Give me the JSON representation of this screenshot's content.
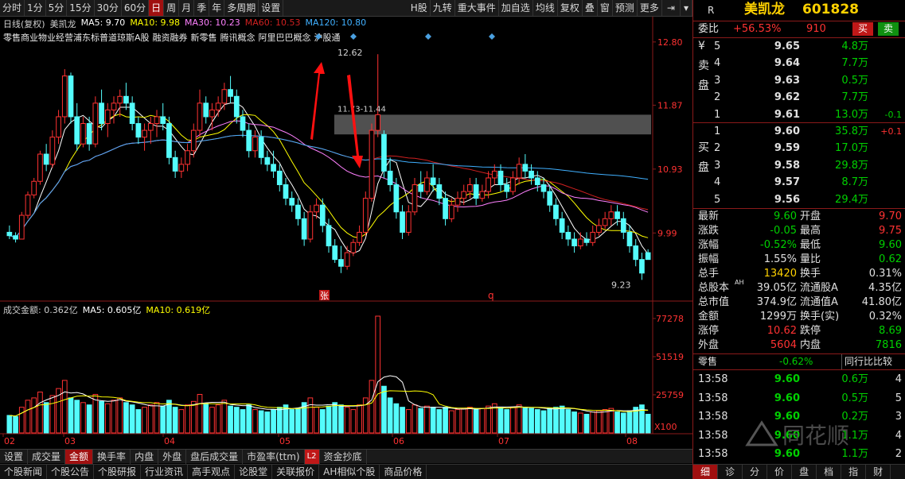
{
  "toolbar": {
    "items": [
      "分时",
      "1分",
      "5分",
      "15分",
      "30分",
      "60分",
      "日",
      "周",
      "月",
      "季",
      "年",
      "多周期",
      "设置"
    ],
    "active_index": 6,
    "right_items": [
      "H股",
      "九转",
      "重大事件",
      "加自选",
      "均线",
      "复权",
      "叠",
      "窗",
      "预测",
      "更多"
    ]
  },
  "stock": {
    "code_letter": "R",
    "name": "美凯龙",
    "code": "601828"
  },
  "legend": {
    "period": "日线(复权)",
    "name": "美凯龙",
    "ma5": "MA5: 9.70",
    "ma10": "MA10: 9.98",
    "ma30": "MA30: 10.23",
    "ma60": "MA60: 10.53",
    "ma120": "MA120: 10.80"
  },
  "concepts": [
    "零售商业物业经营浦东标普道琼斯A股",
    "融资融券",
    "新零售",
    "腾讯概念",
    "阿里巴巴概念",
    "沪股通"
  ],
  "price_axis": {
    "ticks": [
      "12.80",
      "11.87",
      "10.93",
      "9.99"
    ],
    "annot_high": "12.62",
    "annot_gap": "11.73-11.44",
    "annot_low": "9.23"
  },
  "markers": {
    "zhang": "张",
    "q": "q"
  },
  "vol_legend": {
    "label": "成交金额: 0.362亿",
    "ma5": "MA5: 0.605亿",
    "ma10": "MA10: 0.619亿"
  },
  "vol_axis": {
    "ticks": [
      "77278",
      "51519",
      "25759"
    ],
    "unit": "X100"
  },
  "months": [
    "02",
    "03",
    "04",
    "05",
    "06",
    "07",
    "08"
  ],
  "bottom_tabs": [
    "设置",
    "成交量",
    "金额",
    "换手率",
    "内盘",
    "外盘",
    "盘后成交量",
    "市盈率(ttm)",
    "资金抄底"
  ],
  "bottom_active_index": 2,
  "bottom_badge": "L2",
  "news_tabs": [
    "个股新闻",
    "个股公告",
    "个股研报",
    "行业资讯",
    "高手观点",
    "论股堂",
    "关联报价",
    "AH相似个股",
    "商品价格"
  ],
  "weibi": {
    "label": "委比",
    "pct": "+56.53%",
    "diff": "910",
    "buy": "买",
    "sell": "卖"
  },
  "sell_side": {
    "label": [
      "¥",
      "卖",
      "盘"
    ],
    "rows": [
      {
        "n": "5",
        "p": "9.65",
        "v": "4.8万",
        "c": ""
      },
      {
        "n": "4",
        "p": "9.64",
        "v": "7.7万",
        "c": ""
      },
      {
        "n": "3",
        "p": "9.63",
        "v": "0.5万",
        "c": ""
      },
      {
        "n": "2",
        "p": "9.62",
        "v": "7.7万",
        "c": ""
      },
      {
        "n": "1",
        "p": "9.61",
        "v": "13.0万",
        "c": "-0.1"
      }
    ]
  },
  "buy_side": {
    "label": [
      "买",
      "盘"
    ],
    "rows": [
      {
        "n": "1",
        "p": "9.60",
        "v": "35.8万",
        "c": "+0.1"
      },
      {
        "n": "2",
        "p": "9.59",
        "v": "17.0万",
        "c": ""
      },
      {
        "n": "3",
        "p": "9.58",
        "v": "29.8万",
        "c": ""
      },
      {
        "n": "4",
        "p": "9.57",
        "v": "8.7万",
        "c": ""
      },
      {
        "n": "5",
        "p": "9.56",
        "v": "29.4万",
        "c": ""
      }
    ]
  },
  "quote": [
    {
      "l1": "最新",
      "v1": "9.60",
      "c1": "green",
      "l2": "开盘",
      "v2": "9.70",
      "c2": "red"
    },
    {
      "l1": "涨跌",
      "v1": "-0.05",
      "c1": "green",
      "l2": "最高",
      "v2": "9.75",
      "c2": "red"
    },
    {
      "l1": "涨幅",
      "v1": "-0.52%",
      "c1": "green",
      "l2": "最低",
      "v2": "9.60",
      "c2": "green"
    },
    {
      "l1": "振幅",
      "v1": "1.55%",
      "c1": "white",
      "l2": "量比",
      "v2": "0.62",
      "c2": "green"
    },
    {
      "l1": "总手",
      "v1": "13420",
      "c1": "yellow",
      "l2": "换手",
      "v2": "0.31%",
      "c2": "white"
    },
    {
      "l1": "总股本",
      "v1": "39.05亿",
      "c1": "white",
      "l2": "流通股A",
      "v2": "4.35亿",
      "c2": "white"
    },
    {
      "l1": "总市值",
      "v1": "374.9亿",
      "c1": "white",
      "l2": "流通值A",
      "v2": "41.80亿",
      "c2": "white"
    },
    {
      "l1": "金额",
      "v1": "1299万",
      "c1": "white",
      "l2": "换手(实)",
      "v2": "0.32%",
      "c2": "white"
    },
    {
      "l1": "涨停",
      "v1": "10.62",
      "c1": "red",
      "l2": "跌停",
      "v2": "8.69",
      "c2": "green"
    },
    {
      "l1": "外盘",
      "v1": "5604",
      "c1": "red",
      "l2": "内盘",
      "v2": "7816",
      "c2": "green"
    }
  ],
  "ah_sup": "AH",
  "sector": {
    "label": "零售",
    "pct": "-0.62%",
    "compare": "同行比比较"
  },
  "ticks": [
    {
      "t": "13:58",
      "p": "9.60",
      "v": "0.6万",
      "n": "4"
    },
    {
      "t": "13:58",
      "p": "9.60",
      "v": "0.5万",
      "n": "5"
    },
    {
      "t": "13:58",
      "p": "9.60",
      "v": "0.2万",
      "n": "3"
    },
    {
      "t": "13:58",
      "p": "9.60",
      "v": "1.1万",
      "n": "4"
    },
    {
      "t": "13:58",
      "p": "9.60",
      "v": "1.1万",
      "n": "2"
    }
  ],
  "watermark": "同花顺",
  "right_tabs": [
    "细",
    "诊",
    "分",
    "价",
    "盘",
    "档",
    "指",
    "财"
  ],
  "colors": {
    "up": "#ff3232",
    "down": "#54fcfc",
    "ma5": "#ffffff",
    "ma10": "#ffff00",
    "ma30": "#ff80ff",
    "ma60": "#d02020",
    "ma120": "#40b0ff"
  },
  "chart_data": {
    "type": "candlestick",
    "ylim": [
      9.0,
      12.95
    ],
    "vol_max": 77278,
    "candles": [
      [
        10.0,
        10.1,
        9.9,
        9.95
      ],
      [
        9.95,
        10.0,
        9.85,
        9.9
      ],
      [
        9.9,
        10.3,
        9.9,
        10.25
      ],
      [
        10.25,
        10.6,
        10.2,
        10.55
      ],
      [
        10.55,
        10.8,
        10.5,
        10.75
      ],
      [
        10.75,
        11.2,
        10.7,
        11.15
      ],
      [
        11.15,
        11.3,
        10.9,
        11.0
      ],
      [
        11.0,
        11.5,
        10.95,
        11.4
      ],
      [
        11.4,
        11.8,
        11.3,
        11.7
      ],
      [
        11.7,
        12.4,
        11.6,
        12.3
      ],
      [
        12.3,
        12.35,
        11.6,
        11.7
      ],
      [
        11.7,
        11.9,
        11.2,
        11.3
      ],
      [
        11.3,
        11.7,
        11.25,
        11.6
      ],
      [
        11.6,
        11.7,
        11.2,
        11.3
      ],
      [
        11.3,
        12.0,
        11.25,
        11.9
      ],
      [
        11.9,
        12.1,
        11.5,
        11.6
      ],
      [
        11.6,
        11.9,
        11.4,
        11.8
      ],
      [
        11.8,
        12.0,
        11.6,
        11.9
      ],
      [
        11.9,
        12.1,
        11.7,
        12.0
      ],
      [
        12.0,
        12.2,
        11.8,
        11.9
      ],
      [
        11.9,
        12.0,
        11.5,
        11.6
      ],
      [
        11.6,
        11.7,
        11.3,
        11.4
      ],
      [
        11.4,
        11.6,
        11.2,
        11.5
      ],
      [
        11.5,
        11.7,
        11.3,
        11.6
      ],
      [
        11.6,
        11.8,
        11.4,
        11.7
      ],
      [
        11.7,
        11.9,
        11.5,
        11.6
      ],
      [
        11.6,
        11.7,
        11.0,
        11.1
      ],
      [
        11.1,
        11.2,
        10.8,
        10.9
      ],
      [
        10.9,
        11.1,
        10.8,
        11.0
      ],
      [
        11.0,
        11.3,
        10.9,
        11.2
      ],
      [
        11.2,
        11.6,
        11.1,
        11.5
      ],
      [
        11.5,
        12.1,
        11.4,
        11.9
      ],
      [
        11.9,
        12.0,
        11.6,
        11.7
      ],
      [
        11.7,
        11.9,
        11.5,
        11.8
      ],
      [
        11.8,
        12.0,
        11.7,
        11.9
      ],
      [
        11.9,
        12.2,
        11.8,
        12.1
      ],
      [
        12.1,
        12.3,
        11.9,
        12.0
      ],
      [
        12.0,
        12.1,
        11.6,
        11.7
      ],
      [
        11.7,
        11.8,
        11.4,
        11.5
      ],
      [
        11.5,
        11.6,
        11.1,
        11.2
      ],
      [
        11.2,
        11.5,
        11.1,
        11.4
      ],
      [
        11.4,
        11.5,
        11.0,
        11.1
      ],
      [
        11.1,
        11.2,
        10.9,
        11.0
      ],
      [
        11.0,
        11.2,
        10.8,
        10.9
      ],
      [
        10.9,
        11.0,
        10.6,
        10.7
      ],
      [
        10.7,
        10.8,
        10.4,
        10.5
      ],
      [
        10.5,
        10.6,
        10.3,
        10.4
      ],
      [
        10.4,
        10.5,
        10.1,
        10.2
      ],
      [
        10.2,
        10.3,
        9.8,
        9.9
      ],
      [
        9.9,
        10.4,
        9.85,
        10.3
      ],
      [
        10.3,
        10.5,
        10.2,
        10.4
      ],
      [
        10.4,
        10.5,
        10.0,
        10.1
      ],
      [
        10.1,
        10.2,
        9.7,
        9.8
      ],
      [
        9.8,
        9.9,
        9.55,
        9.6
      ],
      [
        9.6,
        9.8,
        9.4,
        9.5
      ],
      [
        9.5,
        9.8,
        9.45,
        9.7
      ],
      [
        9.7,
        9.9,
        9.65,
        9.85
      ],
      [
        9.85,
        10.1,
        9.8,
        10.0
      ],
      [
        10.0,
        10.6,
        9.95,
        10.5
      ],
      [
        10.5,
        11.6,
        10.45,
        11.5
      ],
      [
        11.5,
        12.62,
        11.4,
        11.73
      ],
      [
        11.44,
        11.5,
        10.8,
        10.9
      ],
      [
        10.9,
        11.1,
        10.6,
        10.7
      ],
      [
        10.7,
        10.8,
        10.2,
        10.3
      ],
      [
        10.3,
        10.4,
        9.9,
        10.0
      ],
      [
        10.0,
        10.4,
        9.95,
        10.3
      ],
      [
        10.3,
        10.8,
        10.25,
        10.7
      ],
      [
        10.7,
        10.9,
        10.5,
        10.6
      ],
      [
        10.6,
        10.9,
        10.55,
        10.8
      ],
      [
        10.8,
        11.0,
        10.6,
        10.7
      ],
      [
        10.7,
        10.8,
        10.4,
        10.5
      ],
      [
        10.5,
        10.6,
        10.1,
        10.2
      ],
      [
        10.2,
        10.5,
        10.15,
        10.4
      ],
      [
        10.4,
        10.6,
        10.3,
        10.5
      ],
      [
        10.5,
        10.7,
        10.4,
        10.6
      ],
      [
        10.6,
        10.8,
        10.5,
        10.7
      ],
      [
        10.7,
        10.8,
        10.4,
        10.5
      ],
      [
        10.5,
        10.7,
        10.45,
        10.6
      ],
      [
        10.6,
        10.9,
        10.5,
        10.8
      ],
      [
        10.8,
        11.0,
        10.7,
        10.9
      ],
      [
        10.9,
        11.0,
        10.6,
        10.7
      ],
      [
        10.7,
        10.8,
        10.5,
        10.6
      ],
      [
        10.6,
        10.9,
        10.55,
        10.8
      ],
      [
        10.8,
        11.1,
        10.7,
        11.0
      ],
      [
        11.0,
        11.15,
        10.8,
        10.9
      ],
      [
        10.9,
        11.0,
        10.7,
        10.8
      ],
      [
        10.8,
        10.9,
        10.6,
        10.7
      ],
      [
        10.7,
        10.8,
        10.5,
        10.6
      ],
      [
        10.6,
        10.7,
        10.3,
        10.4
      ],
      [
        10.4,
        10.5,
        10.1,
        10.2
      ],
      [
        10.2,
        10.3,
        9.9,
        10.0
      ],
      [
        10.0,
        10.1,
        9.8,
        9.9
      ],
      [
        9.9,
        10.0,
        9.7,
        9.8
      ],
      [
        9.8,
        10.0,
        9.75,
        9.9
      ],
      [
        9.9,
        10.0,
        9.8,
        9.85
      ],
      [
        9.85,
        10.1,
        9.8,
        10.0
      ],
      [
        10.0,
        10.2,
        9.95,
        10.1
      ],
      [
        10.1,
        10.3,
        10.05,
        10.2
      ],
      [
        10.2,
        10.4,
        10.1,
        10.3
      ],
      [
        10.3,
        10.4,
        10.1,
        10.2
      ],
      [
        10.2,
        10.3,
        9.9,
        10.0
      ],
      [
        10.0,
        10.1,
        9.7,
        9.8
      ],
      [
        9.8,
        9.9,
        9.5,
        9.6
      ],
      [
        9.6,
        9.7,
        9.3,
        9.4
      ],
      [
        9.7,
        9.75,
        9.6,
        9.6
      ]
    ],
    "volumes": [
      15,
      14,
      22,
      28,
      30,
      35,
      26,
      32,
      38,
      45,
      30,
      28,
      26,
      24,
      33,
      27,
      25,
      28,
      30,
      26,
      24,
      20,
      22,
      24,
      26,
      23,
      28,
      22,
      20,
      24,
      27,
      33,
      25,
      22,
      24,
      28,
      23,
      22,
      20,
      24,
      20,
      19,
      18,
      20,
      22,
      24,
      20,
      21,
      26,
      30,
      22,
      20,
      23,
      26,
      24,
      22,
      20,
      24,
      30,
      45,
      100,
      40,
      30,
      25,
      22,
      20,
      24,
      21,
      23,
      22,
      20,
      22,
      19,
      20,
      21,
      22,
      20,
      21,
      23,
      25,
      22,
      20,
      22,
      24,
      22,
      21,
      20,
      19,
      21,
      22,
      23,
      20,
      18,
      17,
      16,
      18,
      19,
      20,
      21,
      18,
      17,
      19,
      22,
      24,
      16
    ]
  }
}
